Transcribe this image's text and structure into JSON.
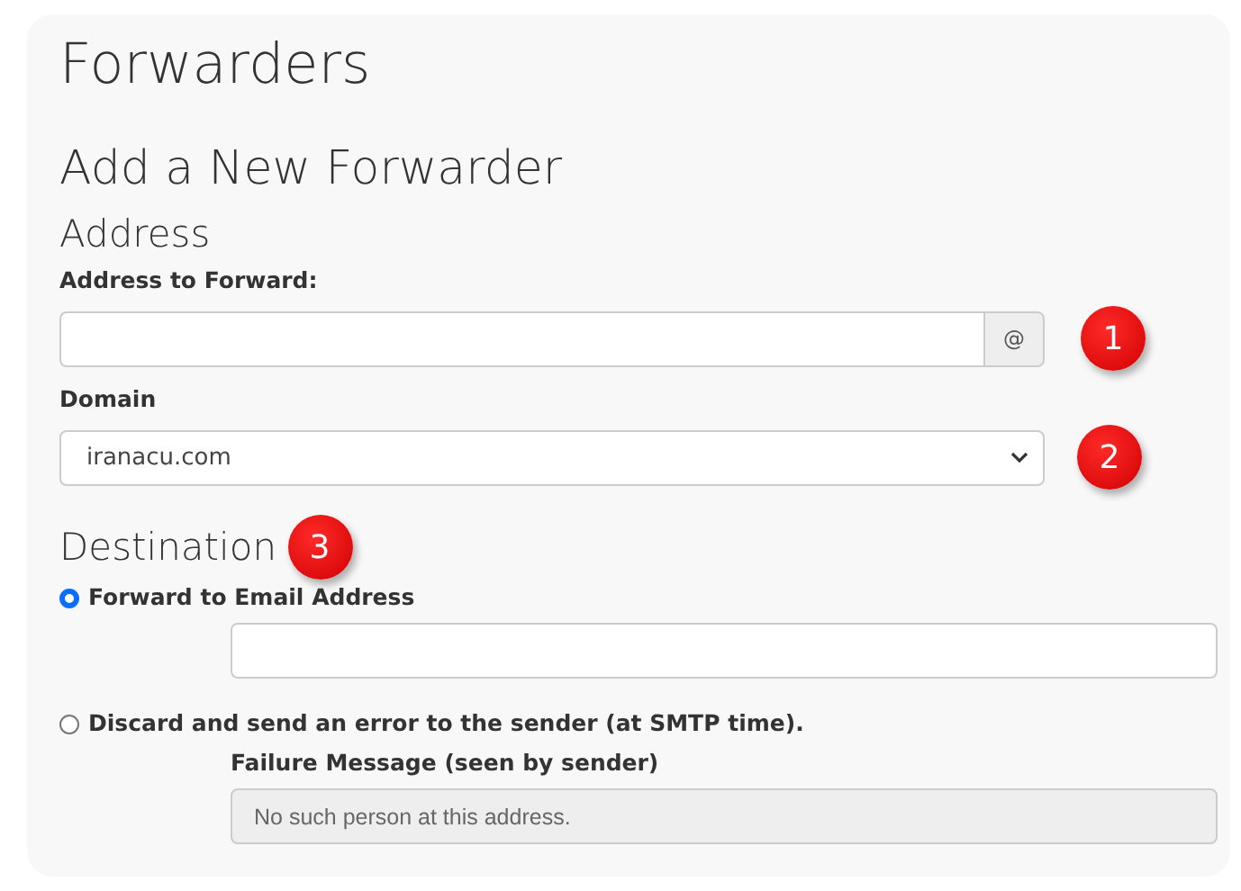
{
  "page_title": "Forwarders",
  "section_title": "Add a New Forwarder",
  "address": {
    "heading": "Address",
    "label": "Address to Forward:",
    "addon": "@",
    "badge": "1"
  },
  "domain": {
    "label": "Domain",
    "value": "iranacu.com",
    "badge": "2"
  },
  "destination": {
    "heading": "Destination",
    "badge": "3",
    "options": [
      {
        "label": "Forward to Email Address",
        "selected": true
      },
      {
        "label": "Discard and send an error to the sender (at SMTP time).",
        "selected": false
      }
    ],
    "failure_label": "Failure Message (seen by sender)",
    "failure_placeholder": "No such person at this address."
  }
}
